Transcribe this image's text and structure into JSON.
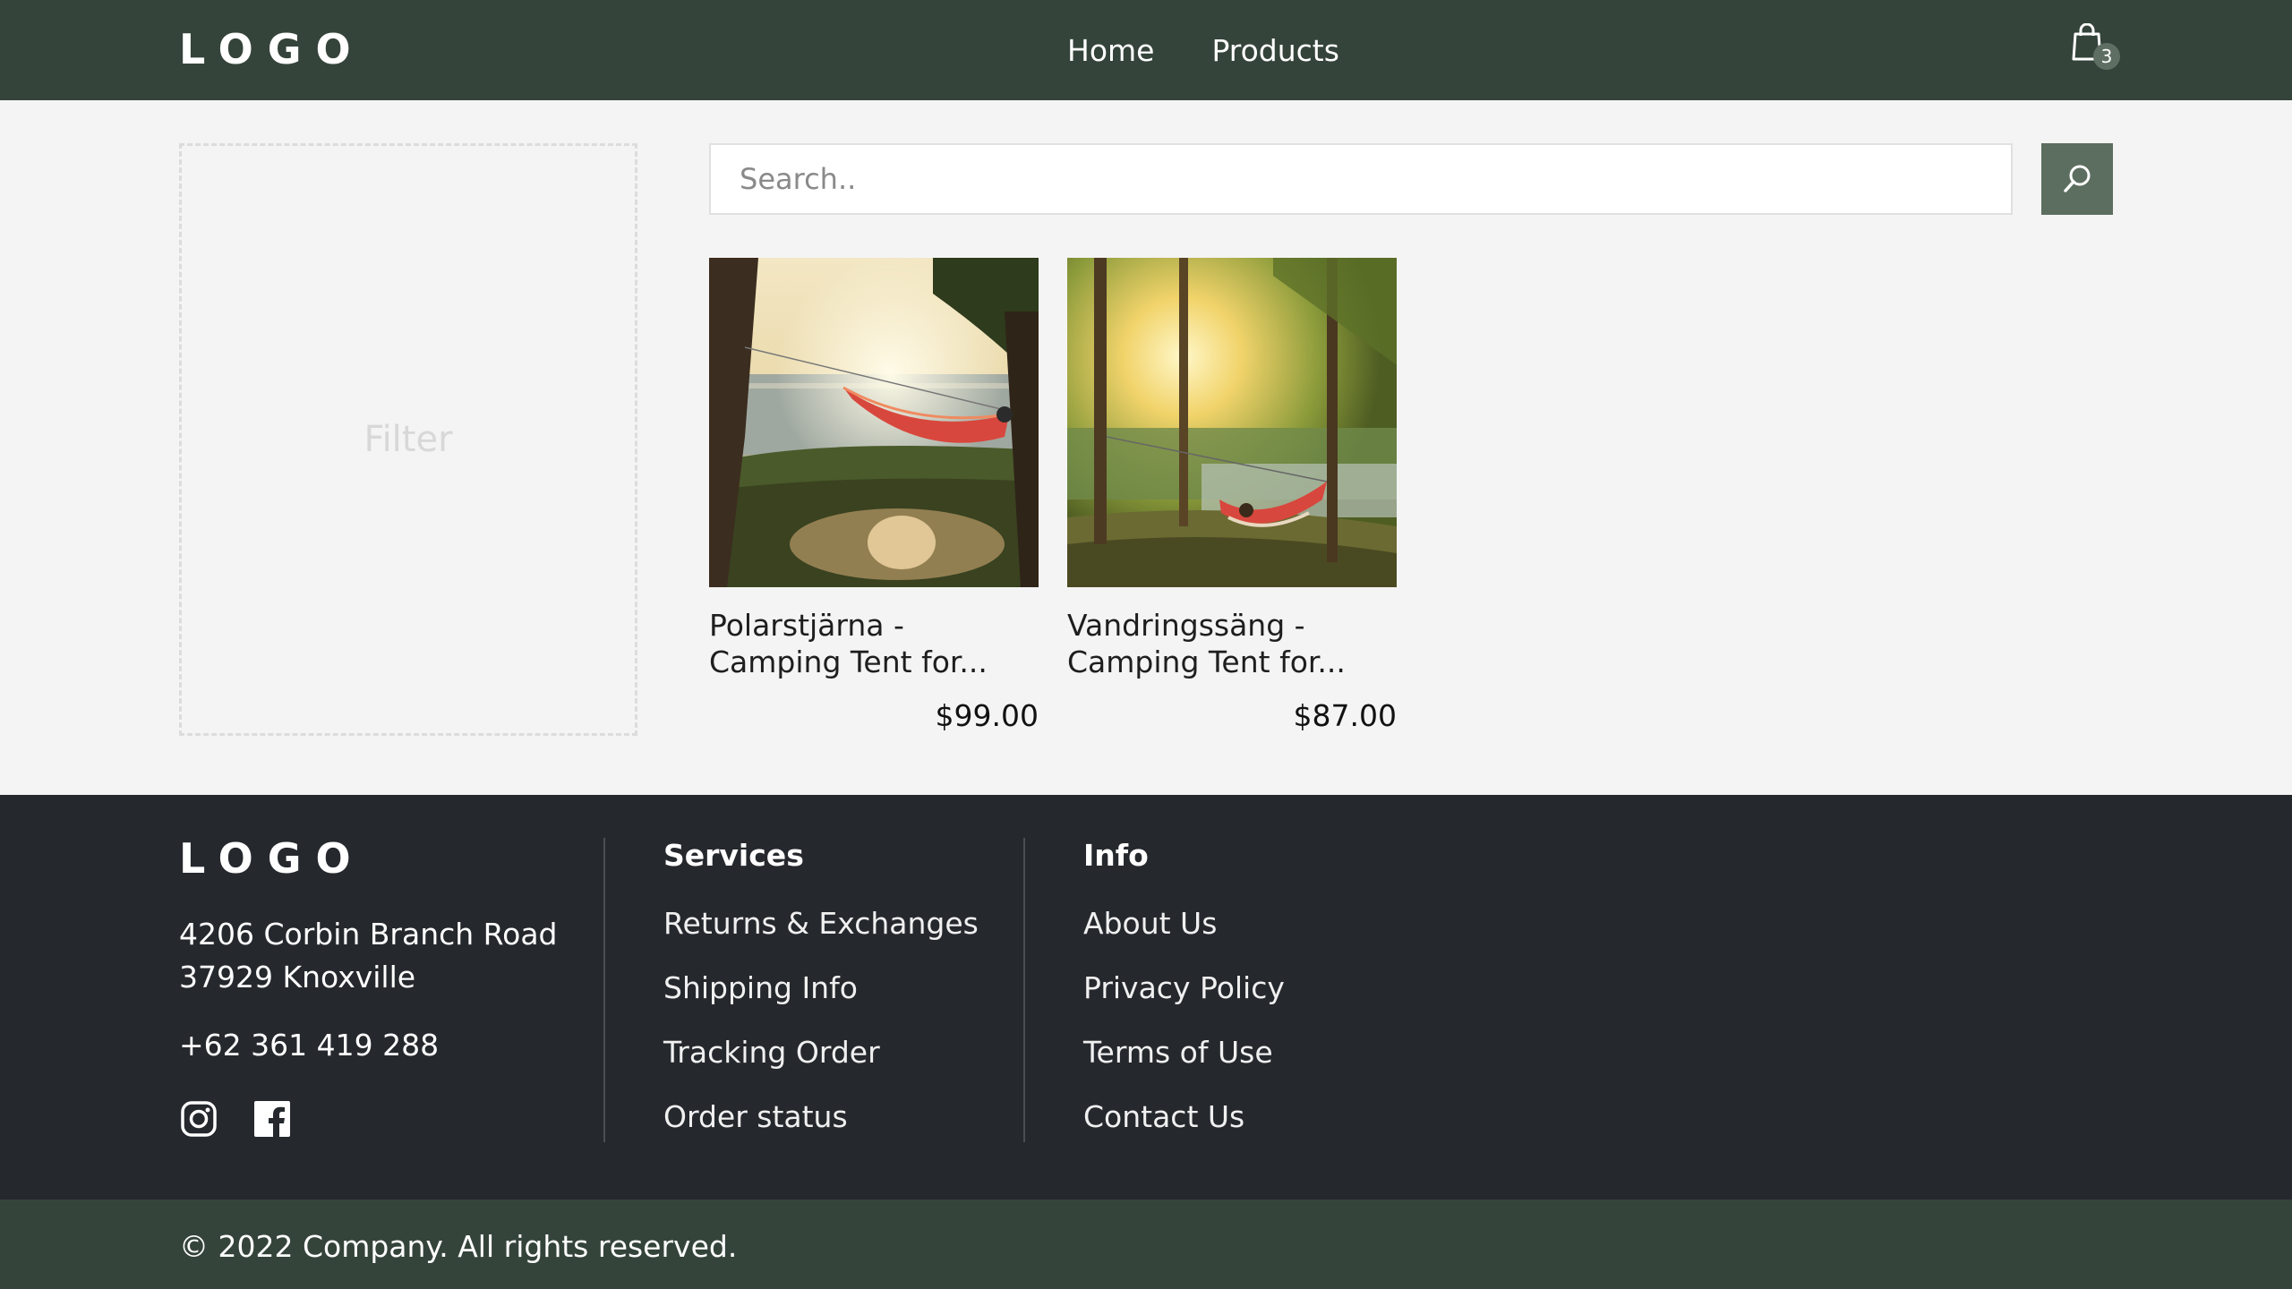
{
  "header": {
    "logo": "LOGO",
    "nav": [
      "Home",
      "Products"
    ],
    "cart_count": "3",
    "cart_icon": "shopping-bag-icon"
  },
  "filter": {
    "label": "Filter"
  },
  "search": {
    "placeholder": "Search..",
    "value": "",
    "icon": "search-icon"
  },
  "products": [
    {
      "title": "Polarstjärna - Camping Tent for...",
      "price": "$99.00"
    },
    {
      "title": "Vandringssäng - Camping Tent for...",
      "price": "$87.00"
    }
  ],
  "footer": {
    "logo": "LOGO",
    "address_line1": "4206 Corbin Branch Road",
    "address_line2": "37929 Knoxville",
    "phone": "+62 361 419 288",
    "social_icons": [
      "instagram-icon",
      "facebook-icon"
    ],
    "services": {
      "heading": "Services",
      "links": [
        "Returns & Exchanges",
        "Shipping Info",
        "Tracking Order",
        "Order status"
      ]
    },
    "info": {
      "heading": "Info",
      "links": [
        "About Us",
        "Privacy Policy",
        "Terms of Use",
        "Contact Us"
      ]
    }
  },
  "copyright": "© 2022 Company. All rights reserved.",
  "colors": {
    "header_bg": "#35443b",
    "footer_bg": "#25282d",
    "accent": "#5c6e60",
    "page_bg": "#f4f4f4"
  }
}
